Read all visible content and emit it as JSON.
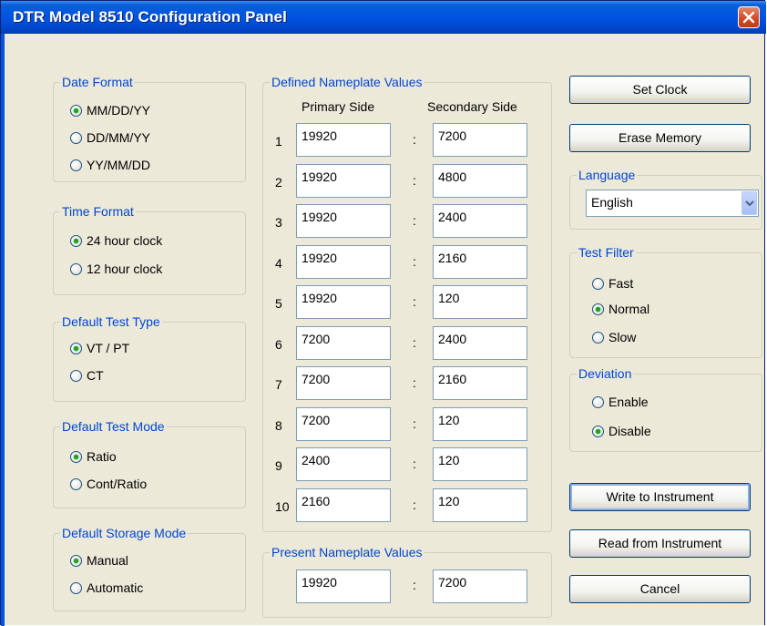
{
  "window": {
    "title": "DTR Model 8510 Configuration Panel"
  },
  "date_format": {
    "label": "Date Format",
    "options": [
      {
        "label": "MM/DD/YY",
        "selected": true
      },
      {
        "label": "DD/MM/YY",
        "selected": false
      },
      {
        "label": "YY/MM/DD",
        "selected": false
      }
    ]
  },
  "time_format": {
    "label": "Time Format",
    "options": [
      {
        "label": "24 hour clock",
        "selected": true
      },
      {
        "label": "12 hour clock",
        "selected": false
      }
    ]
  },
  "test_type": {
    "label": "Default Test Type",
    "options": [
      {
        "label": "VT / PT",
        "selected": true
      },
      {
        "label": "CT",
        "selected": false
      }
    ]
  },
  "test_mode": {
    "label": "Default Test Mode",
    "options": [
      {
        "label": "Ratio",
        "selected": true
      },
      {
        "label": "Cont/Ratio",
        "selected": false
      }
    ]
  },
  "storage_mode": {
    "label": "Default Storage Mode",
    "options": [
      {
        "label": "Manual",
        "selected": true
      },
      {
        "label": "Automatic",
        "selected": false
      }
    ]
  },
  "defined": {
    "label": "Defined Nameplate Values",
    "primary_header": "Primary Side",
    "secondary_header": "Secondary Side",
    "separator": ":",
    "rows": [
      {
        "num": "1",
        "primary": "19920",
        "secondary": "7200"
      },
      {
        "num": "2",
        "primary": "19920",
        "secondary": "4800"
      },
      {
        "num": "3",
        "primary": "19920",
        "secondary": "2400"
      },
      {
        "num": "4",
        "primary": "19920",
        "secondary": "2160"
      },
      {
        "num": "5",
        "primary": "19920",
        "secondary": "120"
      },
      {
        "num": "6",
        "primary": "7200",
        "secondary": "2400"
      },
      {
        "num": "7",
        "primary": "7200",
        "secondary": "2160"
      },
      {
        "num": "8",
        "primary": "7200",
        "secondary": "120"
      },
      {
        "num": "9",
        "primary": "2400",
        "secondary": "120"
      },
      {
        "num": "10",
        "primary": "2160",
        "secondary": "120"
      }
    ]
  },
  "present": {
    "label": "Present Nameplate Values",
    "primary": "19920",
    "secondary": "7200",
    "separator": ":"
  },
  "buttons": {
    "set_clock": "Set Clock",
    "erase_memory": "Erase Memory",
    "write": "Write to Instrument",
    "read": "Read from Instrument",
    "cancel": "Cancel"
  },
  "language": {
    "label": "Language",
    "value": "English"
  },
  "test_filter": {
    "label": "Test Filter",
    "options": [
      {
        "label": "Fast",
        "selected": false
      },
      {
        "label": "Normal",
        "selected": true
      },
      {
        "label": "Slow",
        "selected": false
      }
    ]
  },
  "deviation": {
    "label": "Deviation",
    "options": [
      {
        "label": "Enable",
        "selected": false
      },
      {
        "label": "Disable",
        "selected": true
      }
    ]
  },
  "colors": {
    "titlebar": "#0054e3",
    "group_label": "#0046d5",
    "panel_bg": "#ece9d8",
    "radio_dot": "#21a121"
  }
}
